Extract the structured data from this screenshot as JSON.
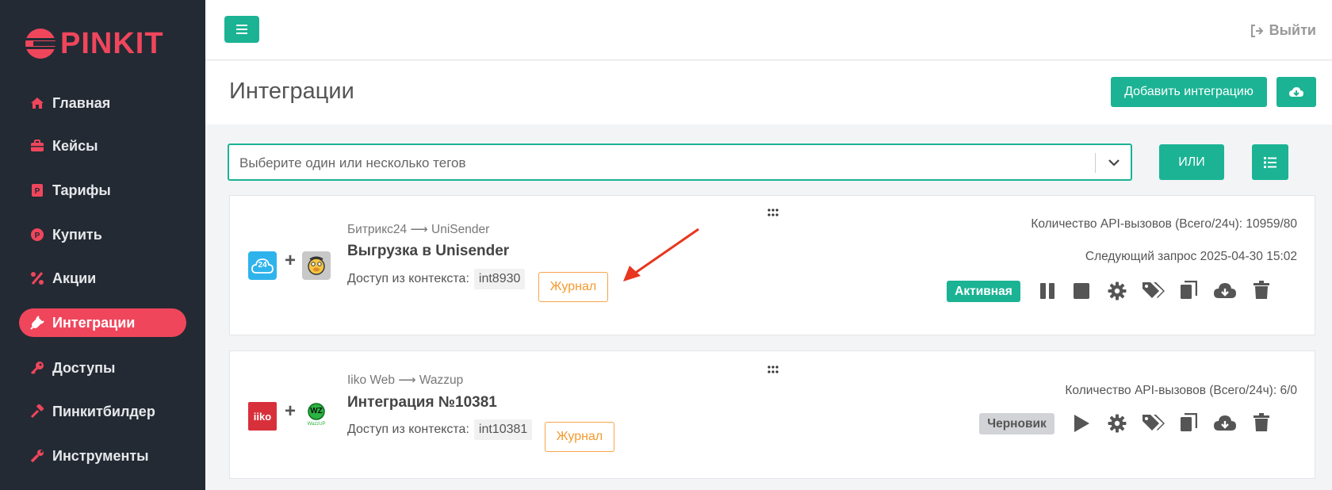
{
  "brand": {
    "name": "PINKIT",
    "color": "#f0465c"
  },
  "sidebar": {
    "items": [
      {
        "label": "Главная",
        "icon": "home-icon"
      },
      {
        "label": "Кейсы",
        "icon": "briefcase-icon"
      },
      {
        "label": "Тарифы",
        "icon": "tariff-icon"
      },
      {
        "label": "Купить",
        "icon": "coin-icon"
      },
      {
        "label": "Акции",
        "icon": "percent-icon"
      },
      {
        "label": "Интеграции",
        "icon": "plug-icon",
        "active": true
      },
      {
        "label": "Доступы",
        "icon": "key-icon"
      },
      {
        "label": "Пинкитбилдер",
        "icon": "hammer-icon"
      },
      {
        "label": "Инструменты",
        "icon": "wrench-icon"
      }
    ]
  },
  "topbar": {
    "logout_label": "Выйти"
  },
  "header": {
    "title": "Интеграции",
    "add_button": "Добавить интеграцию"
  },
  "filter": {
    "placeholder": "Выберите один или несколько тегов",
    "or_button": "ИЛИ"
  },
  "integrations": [
    {
      "route_from": "Битрикс24",
      "route_to": "UniSender",
      "title": "Выгрузка в Unisender",
      "access_label": "Доступ из контекста:",
      "access_code": "int8930",
      "log_button": "Журнал",
      "api_calls": "Количество API-вызовов (Всего/24ч): 10959/80",
      "next_request": "Следующий запрос 2025-04-30 15:02",
      "status": "Активная"
    },
    {
      "route_from": "Iiko Web",
      "route_to": "Wazzup",
      "title": "Интеграция №10381",
      "access_label": "Доступ из контекста:",
      "access_code": "int10381",
      "log_button": "Журнал",
      "api_calls": "Количество API-вызовов (Всего/24ч): 6/0",
      "status": "Черновик"
    }
  ],
  "service_logos": {
    "iiko": "iiko",
    "wazzup": "WZ",
    "wazzup_sub": "WazzUP",
    "bitrix": "24"
  },
  "colors": {
    "accent": "#1bb394",
    "sidebar_bg": "#232a34",
    "log_orange": "#f59a2d",
    "arrow_red": "#e8361f"
  }
}
